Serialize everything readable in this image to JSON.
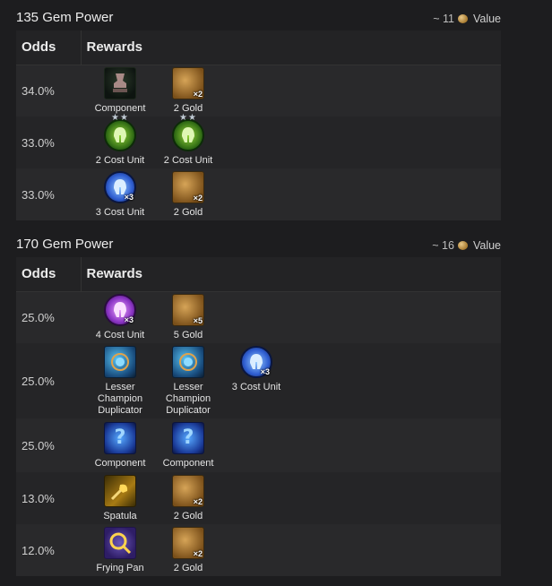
{
  "sections": [
    {
      "title": "135 Gem Power",
      "value_prefix": "~ 11",
      "value_suffix": "Value",
      "header_odds": "Odds",
      "header_rewards": "Rewards",
      "rows": [
        {
          "odds": "34.0%",
          "items": [
            {
              "label": "Component",
              "icon": "anvil-icon",
              "qty": ""
            },
            {
              "label": "2 Gold",
              "icon": "gold-coins-icon",
              "qty": "×2"
            }
          ]
        },
        {
          "odds": "33.0%",
          "items": [
            {
              "label": "2 Cost Unit",
              "icon": "green-helmet-icon",
              "qty": "",
              "stars": "★★"
            },
            {
              "label": "2 Cost Unit",
              "icon": "green-helmet-icon",
              "qty": "",
              "stars": "★★"
            }
          ]
        },
        {
          "odds": "33.0%",
          "items": [
            {
              "label": "3 Cost Unit",
              "icon": "blue-helmet-icon",
              "qty": "×3"
            },
            {
              "label": "2 Gold",
              "icon": "gold-coins-icon",
              "qty": "×2"
            }
          ]
        }
      ]
    },
    {
      "title": "170 Gem Power",
      "value_prefix": "~ 16",
      "value_suffix": "Value",
      "header_odds": "Odds",
      "header_rewards": "Rewards",
      "rows": [
        {
          "odds": "25.0%",
          "items": [
            {
              "label": "4 Cost Unit",
              "icon": "purple-helmet-icon",
              "qty": "×3"
            },
            {
              "label": "5 Gold",
              "icon": "gold-coins-icon",
              "qty": "×5"
            }
          ]
        },
        {
          "odds": "25.0%",
          "items": [
            {
              "label": "Lesser Champion Duplicator",
              "icon": "duplicator-orb-icon",
              "qty": ""
            },
            {
              "label": "Lesser Champion Duplicator",
              "icon": "duplicator-orb-icon",
              "qty": ""
            },
            {
              "label": "3 Cost Unit",
              "icon": "blue-helmet-icon",
              "qty": "×3"
            }
          ]
        },
        {
          "odds": "25.0%",
          "items": [
            {
              "label": "Component",
              "icon": "mystery-component-icon",
              "qty": ""
            },
            {
              "label": "Component",
              "icon": "mystery-component-icon",
              "qty": ""
            }
          ]
        },
        {
          "odds": "13.0%",
          "items": [
            {
              "label": "Spatula",
              "icon": "spatula-icon",
              "qty": ""
            },
            {
              "label": "2 Gold",
              "icon": "gold-coins-icon",
              "qty": "×2"
            }
          ]
        },
        {
          "odds": "12.0%",
          "items": [
            {
              "label": "Frying Pan",
              "icon": "frying-pan-icon",
              "qty": ""
            },
            {
              "label": "2 Gold",
              "icon": "gold-coins-icon",
              "qty": "×2"
            }
          ]
        }
      ]
    }
  ]
}
